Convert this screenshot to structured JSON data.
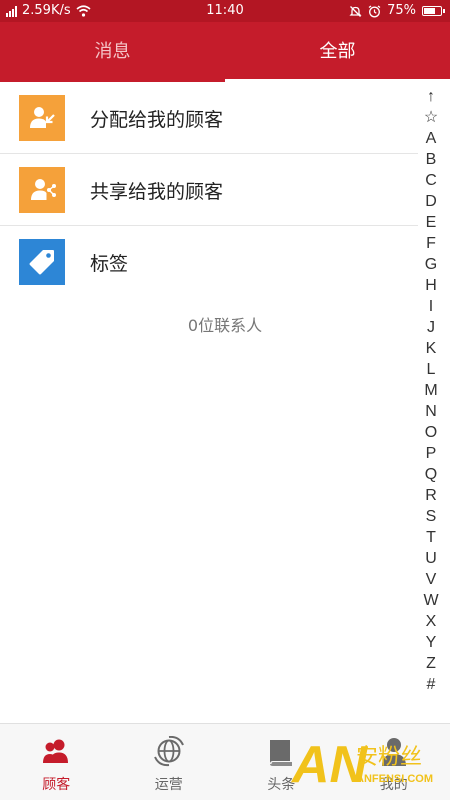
{
  "status_bar": {
    "network_speed": "2.59K/s",
    "time": "11:40",
    "battery": "75%",
    "battery_level": 0.75
  },
  "tabs": [
    {
      "label": "消息",
      "active": false
    },
    {
      "label": "全部",
      "active": true
    }
  ],
  "menu": [
    {
      "label": "分配给我的顾客",
      "icon": "assigned-customer-icon",
      "color": "#f5a13a"
    },
    {
      "label": "共享给我的顾客",
      "icon": "shared-customer-icon",
      "color": "#f5a13a"
    },
    {
      "label": "标签",
      "icon": "tag-icon",
      "color": "#2d86d6"
    }
  ],
  "contact_count": "0位联系人",
  "alphabet_index": [
    "↑",
    "☆",
    "A",
    "B",
    "C",
    "D",
    "E",
    "F",
    "G",
    "H",
    "I",
    "J",
    "K",
    "L",
    "M",
    "N",
    "O",
    "P",
    "Q",
    "R",
    "S",
    "T",
    "U",
    "V",
    "W",
    "X",
    "Y",
    "Z",
    "#"
  ],
  "bottom_nav": [
    {
      "label": "顾客",
      "icon": "customers-icon",
      "active": true
    },
    {
      "label": "运营",
      "icon": "globe-refresh-icon",
      "active": false
    },
    {
      "label": "头条",
      "icon": "book-icon",
      "active": false
    },
    {
      "label": "我的",
      "icon": "profile-icon",
      "active": false
    }
  ],
  "watermark": {
    "logo": "AN",
    "brand": "安粉丝",
    "domain": "ANFENSI.COM"
  },
  "colors": {
    "primary": "#c51c2b",
    "status_bar": "#b31623",
    "orange": "#f5a13a",
    "blue": "#2d86d6"
  }
}
